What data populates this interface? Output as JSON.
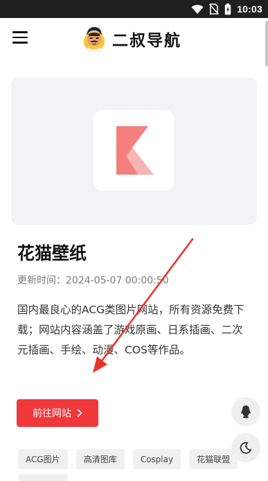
{
  "status_bar": {
    "time": "10:03",
    "icons": [
      "wifi-icon",
      "no-sim-icon",
      "battery-charging-icon"
    ]
  },
  "app_bar": {
    "menu_icon": "menu-icon",
    "brand_title": "二叔导航"
  },
  "site": {
    "title": "花猫壁纸",
    "updated": "更新时间：2024-05-07 00:00:50",
    "description": "国内最良心的ACG类图片网站，所有资源免费下载；网站内容涵盖了游戏原画、日系插画、二次元插画、手绘、动漫、COS等作品。",
    "visit_label": "前往网站",
    "tags": [
      "ACG图片",
      "高清图库",
      "Cosplay",
      "花猫联盟"
    ]
  },
  "floating": {
    "qq_icon": "qq-penguin-icon",
    "theme_icon": "moon-theme-icon"
  },
  "colors": {
    "accent": "#f0383a",
    "logo": "#f47f7d",
    "annotation_arrow": "#e8342c"
  }
}
